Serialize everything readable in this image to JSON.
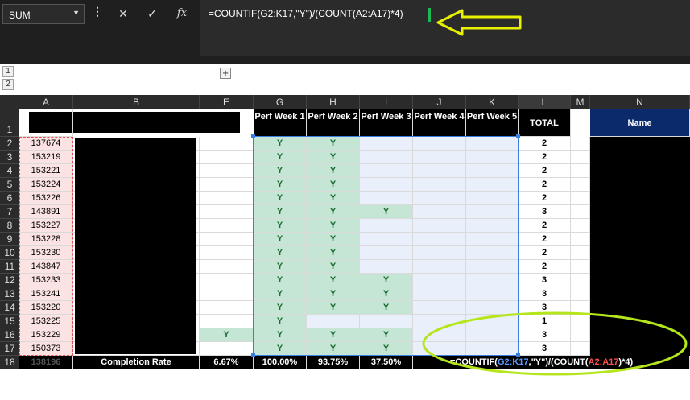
{
  "name_box": {
    "value": "SUM"
  },
  "formula_bar": {
    "cancel_icon": "close-icon",
    "enter_icon": "check-icon",
    "fx_label": "fx",
    "formula": "=COUNTIF(G2:K17,\"Y\")/(COUNT(A2:A17)*4)"
  },
  "outline": {
    "levels": [
      "1",
      "2"
    ],
    "expand": "+"
  },
  "columns": [
    "A",
    "B",
    "E",
    "G",
    "H",
    "I",
    "J",
    "K",
    "L",
    "M",
    "N"
  ],
  "rows": [
    "1",
    "2",
    "3",
    "4",
    "5",
    "6",
    "7",
    "8",
    "9",
    "10",
    "11",
    "12",
    "13",
    "14",
    "15",
    "16",
    "17",
    "18"
  ],
  "header_row": {
    "G": "Perf Week 1",
    "H": "Perf Week 2",
    "I": "Perf Week 3",
    "J": "Perf Week 4",
    "K": "Perf Week 5",
    "L": "TOTAL",
    "N": "Name"
  },
  "data_rows": [
    {
      "A": "137674",
      "E": "",
      "G": "Y",
      "H": "Y",
      "I": "",
      "J": "",
      "K": "",
      "L": "2"
    },
    {
      "A": "153219",
      "E": "",
      "G": "Y",
      "H": "Y",
      "I": "",
      "J": "",
      "K": "",
      "L": "2"
    },
    {
      "A": "153221",
      "E": "",
      "G": "Y",
      "H": "Y",
      "I": "",
      "J": "",
      "K": "",
      "L": "2"
    },
    {
      "A": "153224",
      "E": "",
      "G": "Y",
      "H": "Y",
      "I": "",
      "J": "",
      "K": "",
      "L": "2"
    },
    {
      "A": "153226",
      "E": "",
      "G": "Y",
      "H": "Y",
      "I": "",
      "J": "",
      "K": "",
      "L": "2"
    },
    {
      "A": "143891",
      "E": "",
      "G": "Y",
      "H": "Y",
      "I": "Y",
      "J": "",
      "K": "",
      "L": "3"
    },
    {
      "A": "153227",
      "E": "",
      "G": "Y",
      "H": "Y",
      "I": "",
      "J": "",
      "K": "",
      "L": "2"
    },
    {
      "A": "153228",
      "E": "",
      "G": "Y",
      "H": "Y",
      "I": "",
      "J": "",
      "K": "",
      "L": "2"
    },
    {
      "A": "153230",
      "E": "",
      "G": "Y",
      "H": "Y",
      "I": "",
      "J": "",
      "K": "",
      "L": "2"
    },
    {
      "A": "143847",
      "E": "",
      "G": "Y",
      "H": "Y",
      "I": "",
      "J": "",
      "K": "",
      "L": "2"
    },
    {
      "A": "153233",
      "E": "",
      "G": "Y",
      "H": "Y",
      "I": "Y",
      "J": "",
      "K": "",
      "L": "3"
    },
    {
      "A": "153241",
      "E": "",
      "G": "Y",
      "H": "Y",
      "I": "Y",
      "J": "",
      "K": "",
      "L": "3"
    },
    {
      "A": "153220",
      "E": "",
      "G": "Y",
      "H": "Y",
      "I": "Y",
      "J": "",
      "K": "",
      "L": "3"
    },
    {
      "A": "153225",
      "E": "",
      "G": "Y",
      "H": "",
      "I": "",
      "J": "",
      "K": "",
      "L": "1"
    },
    {
      "A": "153229",
      "E": "Y",
      "G": "Y",
      "H": "Y",
      "I": "Y",
      "J": "",
      "K": "",
      "L": "3"
    },
    {
      "A": "150373",
      "E": "",
      "G": "Y",
      "H": "Y",
      "I": "Y",
      "J": "",
      "K": "",
      "L": "3"
    }
  ],
  "footer_row": {
    "A": "138196",
    "B": "Completion Rate",
    "E": "6.67%",
    "G": "100.00%",
    "H": "93.75%",
    "I": "37.50%",
    "formula_parts": [
      "=COUNTIF(",
      "G2:K17",
      ",\"Y\")/(COUNT(",
      "A2:A17",
      ")*4)"
    ]
  },
  "colors": {
    "y_fill": "#c6e6d5",
    "range_highlight": "#eaf0fb",
    "id_fill": "#fbe3e3",
    "name_header": "#0b2a6b",
    "annotation": "#e7f000"
  }
}
